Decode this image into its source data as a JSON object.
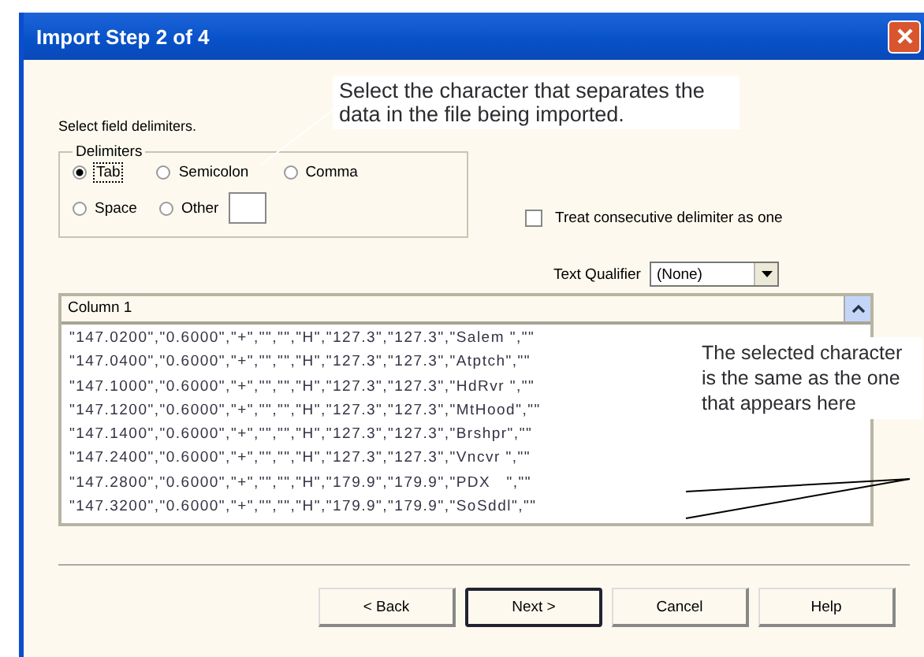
{
  "window": {
    "title": "Import Step 2 of 4"
  },
  "instruction": "Select field delimiters.",
  "callouts": [
    {
      "text": "Select the character that separates the data in the file being imported."
    },
    {
      "text": "The selected character is the same as the one that appears here"
    }
  ],
  "delimiters": {
    "label": "Delimiters",
    "options": [
      {
        "label": "Tab",
        "selected": true
      },
      {
        "label": "Semicolon",
        "selected": false
      },
      {
        "label": "Comma",
        "selected": false
      },
      {
        "label": "Space",
        "selected": false
      },
      {
        "label": "Other",
        "selected": false
      }
    ]
  },
  "consecutive": {
    "label": "Treat consecutive delimiter as one",
    "checked": false
  },
  "text_qualifier": {
    "label": "Text Qualifier",
    "value": "(None)"
  },
  "preview": {
    "columns": [
      "Column 1"
    ],
    "rows": [
      "\"147.0200\",\"0.6000\",\"+\",\"\",\"\",\"H\",\"127.3\",\"127.3\",\"Salem \",\"\"",
      "\"147.0400\",\"0.6000\",\"+\",\"\",\"\",\"H\",\"127.3\",\"127.3\",\"Atptch\",\"\"",
      "\"147.1000\",\"0.6000\",\"+\",\"\",\"\",\"H\",\"127.3\",\"127.3\",\"HdRvr \",\"\"",
      "\"147.1200\",\"0.6000\",\"+\",\"\",\"\",\"H\",\"127.3\",\"127.3\",\"MtHood\",\"\"",
      "\"147.1400\",\"0.6000\",\"+\",\"\",\"\",\"H\",\"127.3\",\"127.3\",\"Brshpr\",\"\"",
      "\"147.2400\",\"0.6000\",\"+\",\"\",\"\",\"H\",\"127.3\",\"127.3\",\"Vncvr \",\"\"",
      "\"147.2800\",\"0.6000\",\"+\",\"\",\"\",\"H\",\"179.9\",\"179.9\",\"PDX   \",\"\"",
      "\"147.3200\",\"0.6000\",\"+\",\"\",\"\",\"H\",\"179.9\",\"179.9\",\"SoSddl\",\"\""
    ]
  },
  "buttons": [
    {
      "label": "< Back",
      "default": false
    },
    {
      "label": "Next >",
      "default": true
    },
    {
      "label": "Cancel",
      "default": false
    },
    {
      "label": "Help",
      "default": false
    }
  ]
}
